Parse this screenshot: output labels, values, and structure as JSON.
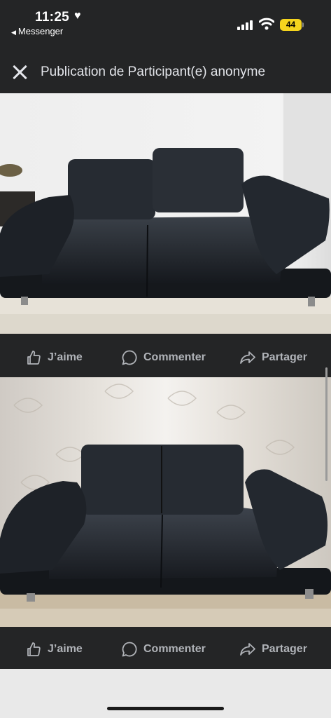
{
  "status": {
    "time": "11:25",
    "back_app": "Messenger",
    "battery": "44"
  },
  "header": {
    "title": "Publication de Participant(e) anonyme"
  },
  "posts": [
    {
      "actions": {
        "like": "J’aime",
        "comment": "Commenter",
        "share": "Partager"
      }
    },
    {
      "actions": {
        "like": "J’aime",
        "comment": "Commenter",
        "share": "Partager"
      }
    }
  ],
  "colors": {
    "background": "#242526",
    "action_text": "#b0b3b8",
    "battery": "#f5d41d",
    "sofa": "#1f2329"
  },
  "icons": [
    "heart-icon",
    "signal-icon",
    "wifi-icon",
    "battery-icon",
    "close-icon",
    "thumbs-up-icon",
    "comment-icon",
    "share-icon"
  ]
}
